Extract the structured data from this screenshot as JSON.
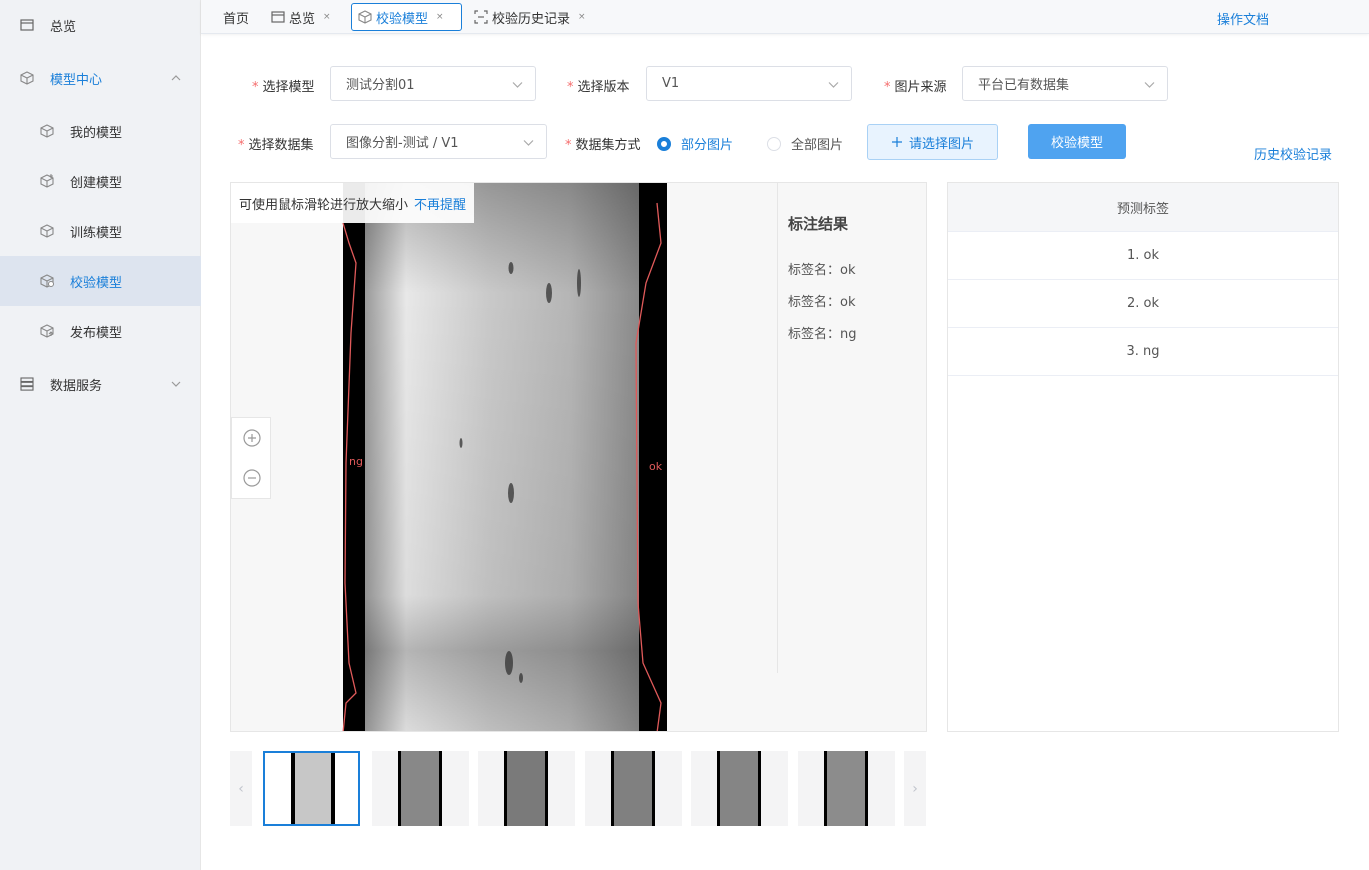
{
  "sidebar": {
    "items": [
      {
        "label": "总览",
        "icon": "overview-icon"
      },
      {
        "label": "模型中心",
        "icon": "cube-icon"
      },
      {
        "label": "我的模型",
        "icon": "cube-icon"
      },
      {
        "label": "创建模型",
        "icon": "cube-plus-icon"
      },
      {
        "label": "训练模型",
        "icon": "cube-icon"
      },
      {
        "label": "校验模型",
        "icon": "cube-check-icon"
      },
      {
        "label": "发布模型",
        "icon": "cube-publish-icon"
      },
      {
        "label": "数据服务",
        "icon": "database-icon"
      }
    ]
  },
  "tabs": {
    "home": "首页",
    "overview": "总览",
    "validate": "校验模型",
    "history": "校验历史记录",
    "close_glyph": "×"
  },
  "header": {
    "docs_link": "操作文档"
  },
  "form": {
    "model_label": "选择模型",
    "model_value": "测试分割01",
    "version_label": "选择版本",
    "version_value": "V1",
    "source_label": "图片来源",
    "source_value": "平台已有数据集",
    "dataset_label": "选择数据集",
    "dataset_value": "图像分割-测试 / V1",
    "mode_label": "数据集方式",
    "mode_partial": "部分图片",
    "mode_all": "全部图片",
    "select_images_button": "请选择图片",
    "validate_button": "校验模型",
    "history_link": "历史校验记录",
    "required_mark": "*"
  },
  "viewer": {
    "hint_text": "可使用鼠标滑轮进行放大缩小",
    "hint_dismiss": "不再提醒",
    "overlay_left_label": "ng",
    "overlay_right_label": "ok",
    "annotation_title": "标注结果",
    "annotations": [
      "标签名：ok",
      "标签名：ok",
      "标签名：ng"
    ]
  },
  "predictions": {
    "header": "预测标签",
    "rows": [
      "1. ok",
      "2. ok",
      "3. ng"
    ]
  },
  "thumbnails": {
    "prev": "‹",
    "next": "›",
    "count": 6,
    "selected_index": 0
  },
  "colors": {
    "accent": "#1a7fd9",
    "primary_button": "#4fa3f0",
    "required": "#f56c6c",
    "overlay_red": "#e05a5a"
  }
}
